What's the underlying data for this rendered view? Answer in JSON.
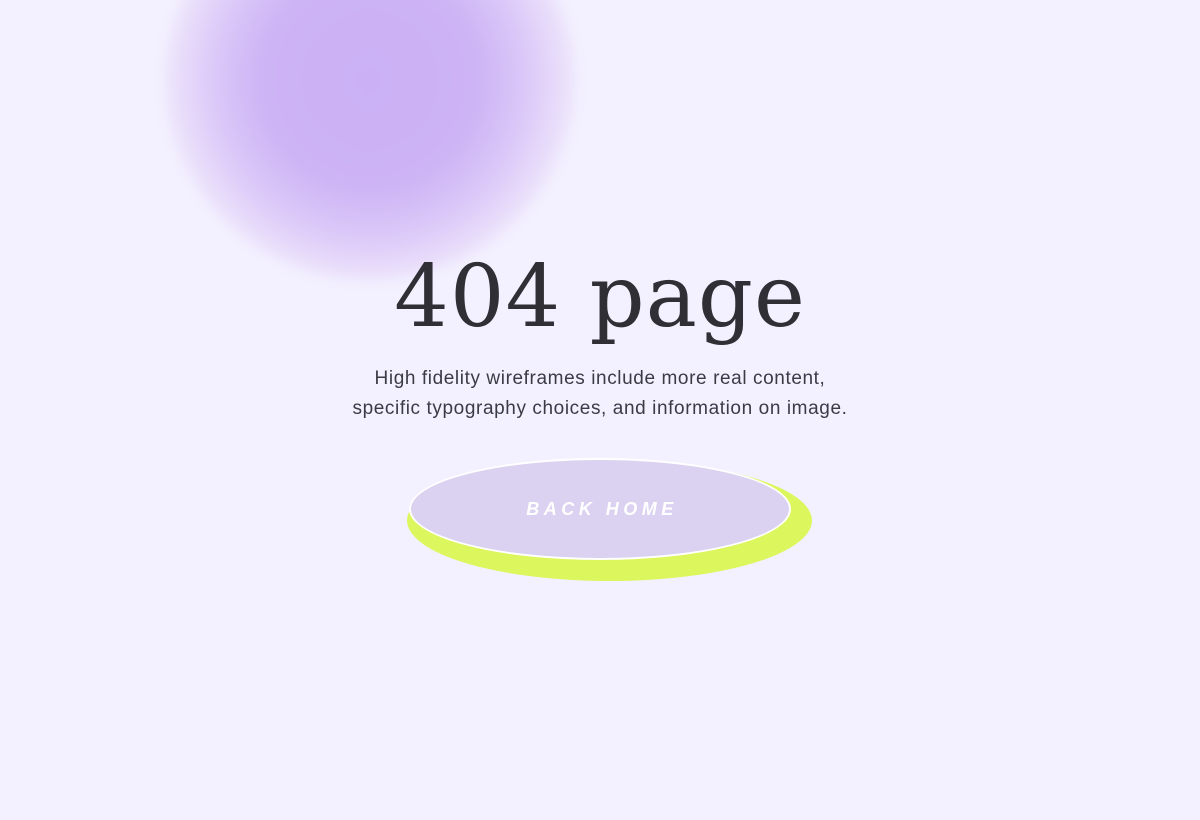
{
  "page": {
    "title": "404 page",
    "description_lines": [
      "High fidelity wireframes include more real content,",
      "specific typography choices, and information on image."
    ]
  },
  "actions": {
    "back_home_label": "BACK HOME"
  },
  "colors": {
    "background": "#f3f1ff",
    "blob": "#cbb0f5",
    "button_fill": "#dbd1f0",
    "button_shadow": "#dcf65d",
    "text": "#2f2f35"
  }
}
